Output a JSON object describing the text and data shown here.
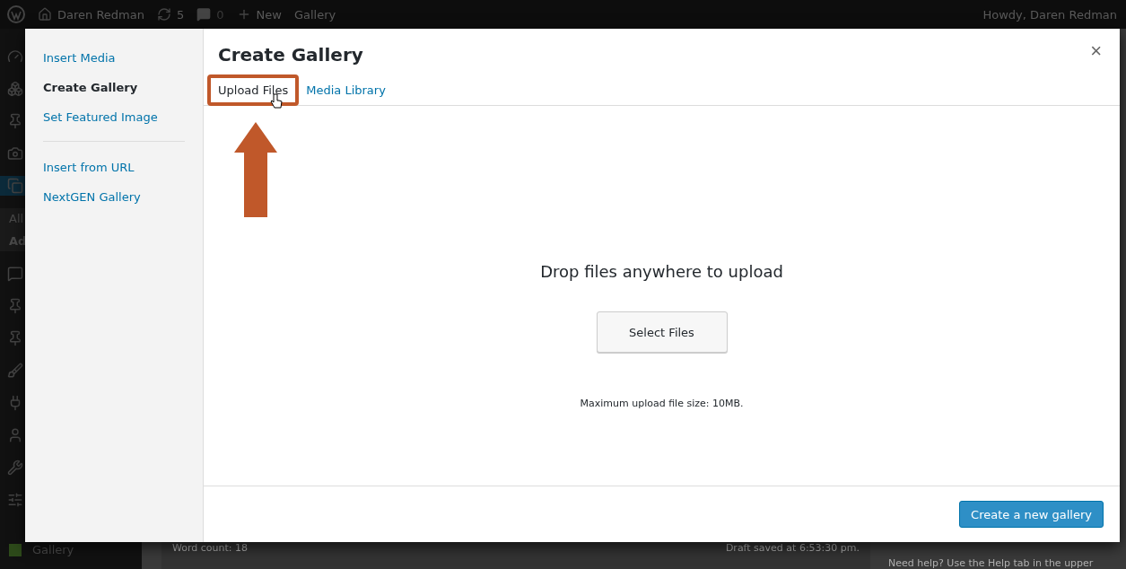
{
  "admin_bar": {
    "site_name": "Daren Redman",
    "updates": "5",
    "comments": "0",
    "new_label": "New",
    "gallery_label": "Gallery",
    "greeting": "Howdy, Daren Redman"
  },
  "admin_menu": {
    "submenu": [
      "All",
      "Ad"
    ],
    "footer_item": "Gallery"
  },
  "editor_footer": {
    "word_count": "Word count: 18",
    "draft_saved": "Draft saved at 6:53:30 pm.",
    "help": "Need help? Use the Help tab in the upper"
  },
  "modal": {
    "menu_groups": [
      [
        {
          "label": "Insert Media",
          "selected": false
        },
        {
          "label": "Create Gallery",
          "selected": true
        },
        {
          "label": "Set Featured Image",
          "selected": false
        }
      ],
      [
        {
          "label": "Insert from URL",
          "selected": false
        },
        {
          "label": "NextGEN Gallery",
          "selected": false
        }
      ]
    ],
    "title": "Create Gallery",
    "close": "×",
    "tabs": [
      {
        "label": "Upload Files",
        "selected": true,
        "highlighted": true
      },
      {
        "label": "Media Library",
        "selected": false,
        "highlighted": false
      }
    ],
    "drop_text": "Drop files anywhere to upload",
    "select_button": "Select Files",
    "max_size": "Maximum upload file size: 10MB.",
    "primary_button": "Create a new gallery"
  }
}
